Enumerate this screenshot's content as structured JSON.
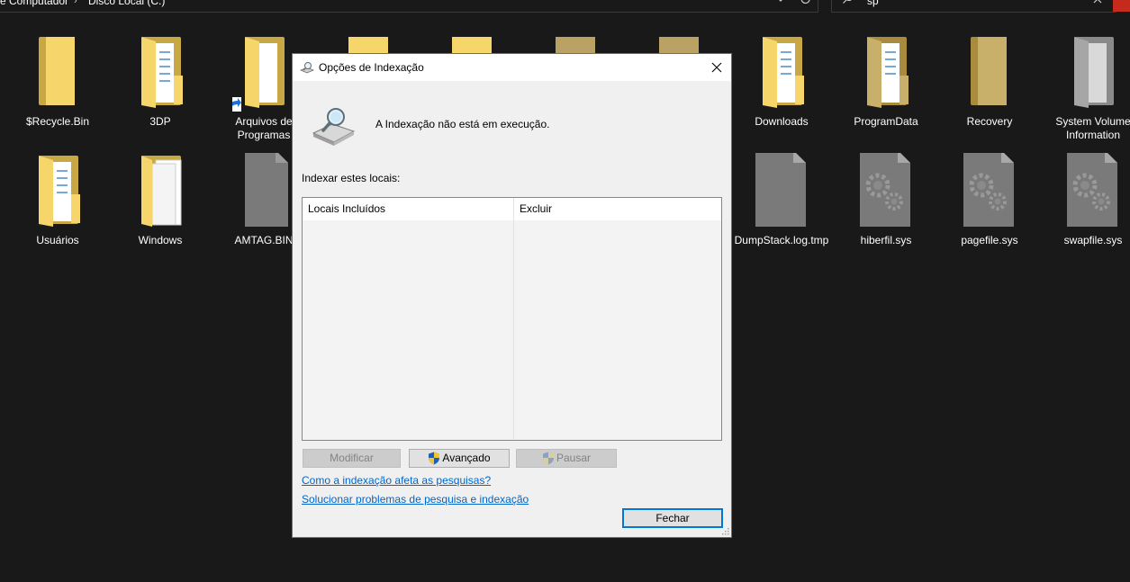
{
  "explorer": {
    "breadcrumb": [
      "e Computador",
      "Disco Local (C:)"
    ],
    "search_value": "sp"
  },
  "files_row1": [
    {
      "label": "$Recycle.Bin",
      "icon": "folder-icon"
    },
    {
      "label": "3DP",
      "icon": "folder-docs-icon"
    },
    {
      "label": "Arquivos de Programas",
      "icon": "folder-shortcut-icon"
    },
    {
      "label": "Downloads",
      "icon": "folder-docs-icon"
    },
    {
      "label": "ProgramData",
      "icon": "folder-docs-icon"
    },
    {
      "label": "Recovery",
      "icon": "folder-icon"
    },
    {
      "label": "System Volume Information",
      "icon": "folder-gray-icon"
    }
  ],
  "files_row2": [
    {
      "label": "Usuários",
      "icon": "folder-docs-icon"
    },
    {
      "label": "Windows",
      "icon": "folder-docs-icon"
    },
    {
      "label": "AMTAG.BIN",
      "icon": "file-icon"
    },
    {
      "label": "DumpStack.log.tmp",
      "icon": "file-icon"
    },
    {
      "label": "hiberfil.sys",
      "icon": "system-file-icon"
    },
    {
      "label": "pagefile.sys",
      "icon": "system-file-icon"
    },
    {
      "label": "swapfile.sys",
      "icon": "system-file-icon"
    }
  ],
  "dialog": {
    "title": "Opções de Indexação",
    "status": "A Indexação não está em execução.",
    "section_label": "Indexar estes locais:",
    "columns": [
      "Locais Incluídos",
      "Excluir"
    ],
    "buttons": {
      "modify": "Modificar",
      "advanced": "Avançado",
      "pause": "Pausar",
      "close": "Fechar"
    },
    "links": [
      "Como a indexação afeta as pesquisas?",
      "Solucionar problemas de pesquisa e indexação"
    ]
  },
  "colors": {
    "background": "#191919",
    "folder": "#f6d56b",
    "link": "#0066cc",
    "accent": "#0078d7"
  }
}
